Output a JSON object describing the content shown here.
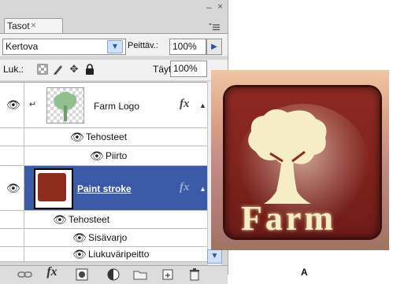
{
  "panel": {
    "tab_label": "Tasot",
    "tab_close": "×",
    "minimize": "–",
    "close": "×",
    "menu_icon": "≡"
  },
  "toolbar1": {
    "blend_mode": "Kertova",
    "opacity_label": "Peittäv.:",
    "opacity_value": "100%"
  },
  "toolbar2": {
    "lock_label": "Luk.:",
    "fill_label": "Täyttö:",
    "fill_value": "100%"
  },
  "layers": [
    {
      "name": "Farm Logo",
      "fx": "fx",
      "selected": false
    },
    {
      "name": "Tehosteet"
    },
    {
      "name": "Piirto"
    },
    {
      "name": "Paint stroke",
      "fx": "fx",
      "selected": true
    },
    {
      "name": "Tehosteet"
    },
    {
      "name": "Sisävarjo"
    },
    {
      "name": "Liukuväripeitto"
    }
  ],
  "bottom_icons": [
    "link-icon",
    "fx-icon",
    "mask-icon",
    "adjustment-icon",
    "group-icon",
    "new-layer-icon",
    "trash-icon"
  ],
  "bottom_fx_label": "fx",
  "artwork": {
    "word": "Farm",
    "caption": "A"
  },
  "colors": {
    "selection": "#3a59a6",
    "stroke": "#8c2d1b",
    "accent": "#2456a6"
  }
}
